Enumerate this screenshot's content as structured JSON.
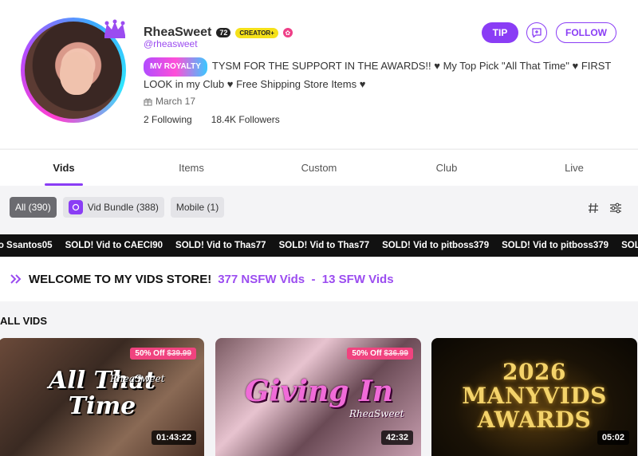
{
  "profile": {
    "name": "RheaSweet",
    "level": "72",
    "creator_badge": "CREATOR+",
    "handle": "@rheasweet",
    "royalty_badge": "MV ROYALTY",
    "bio": "TYSM FOR THE SUPPORT IN THE AWARDS!! ♥ My Top Pick \"All That Time\" ♥ FIRST LOOK in my Club ♥ Free Shipping Store Items ♥",
    "joined": "March 17",
    "following": "2 Following",
    "followers": "18.4K Followers"
  },
  "actions": {
    "tip": "TIP",
    "follow": "FOLLOW"
  },
  "tabs": [
    {
      "label": "Vids",
      "active": true
    },
    {
      "label": "Items"
    },
    {
      "label": "Custom"
    },
    {
      "label": "Club"
    },
    {
      "label": "Live"
    }
  ],
  "filters": [
    {
      "label": "All (390)",
      "active": true
    },
    {
      "label": "Vid Bundle (388)"
    },
    {
      "label": "Mobile (1)"
    }
  ],
  "ticker": [
    "to Ssantos05",
    "SOLD! Vid to CAECI90",
    "SOLD! Vid to Thas77",
    "SOLD! Vid to Thas77",
    "SOLD! Vid to pitboss379",
    "SOLD! Vid to pitboss379",
    "SOLD!"
  ],
  "welcome": {
    "title": "WELCOME TO MY VIDS STORE!",
    "counts": "377 NSFW Vids  -  13 SFW Vids"
  },
  "section_title": "ALL VIDS",
  "videos": [
    {
      "title": "All That Time",
      "watermark": "RheaSweet",
      "discount": "50% Off",
      "old_price": "$39.99",
      "duration": "01:43:22"
    },
    {
      "title": "Giving In",
      "watermark": "RheaSweet",
      "discount": "50% Off",
      "old_price": "$36.99",
      "duration": "42:32"
    },
    {
      "title": "2026 MANYVIDS AWARDS",
      "duration": "05:02"
    }
  ],
  "colors": {
    "accent": "#8a3df5",
    "discount": "#f0437f",
    "creator_badge": "#f5e11a"
  }
}
